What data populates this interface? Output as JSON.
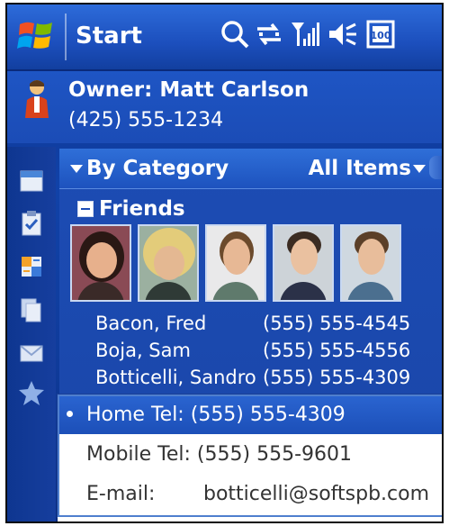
{
  "titlebar": {
    "start_label": "Start",
    "icons": [
      "windows-logo-icon",
      "search-icon",
      "sync-icon",
      "signal-icon",
      "volume-icon",
      "battery-icon"
    ]
  },
  "owner": {
    "name": "Owner: Matt Carlson",
    "phone": "(425) 555-1234",
    "icon": "owner-avatar-icon"
  },
  "rail": {
    "icons": [
      "calendar-icon",
      "clipboard-icon",
      "contacts-icon",
      "documents-icon",
      "mail-icon",
      "favorites-star-icon"
    ]
  },
  "category_bar": {
    "sort_label": "By Category",
    "filter_label": "All Items"
  },
  "group": {
    "label": "Friends"
  },
  "contacts": [
    {
      "name": "Bacon, Fred",
      "phone": "(555) 555-4545",
      "icon": "mobile-phone-icon"
    },
    {
      "name": "Boja, Sam",
      "phone": "(555) 555-4556",
      "icon": "mobile-phone-icon"
    },
    {
      "name": "Botticelli, Sandro",
      "phone": "(555) 555-4309",
      "icon": "home-phone-icon"
    }
  ],
  "popup": {
    "items": [
      {
        "label": "Home Tel:",
        "value": "(555) 555-4309",
        "selected": true
      },
      {
        "label": "Mobile Tel:",
        "value": "(555) 555-9601",
        "selected": false
      },
      {
        "label": "E-mail:",
        "value": "botticelli@softspb.com",
        "selected": false
      }
    ]
  },
  "colors": {
    "accent": "#1c4fb8",
    "background": "#1142a8",
    "popup_bg": "#ffffff",
    "mobile_icon": "#9fcf3a",
    "home_icon": "#e23a3a"
  }
}
